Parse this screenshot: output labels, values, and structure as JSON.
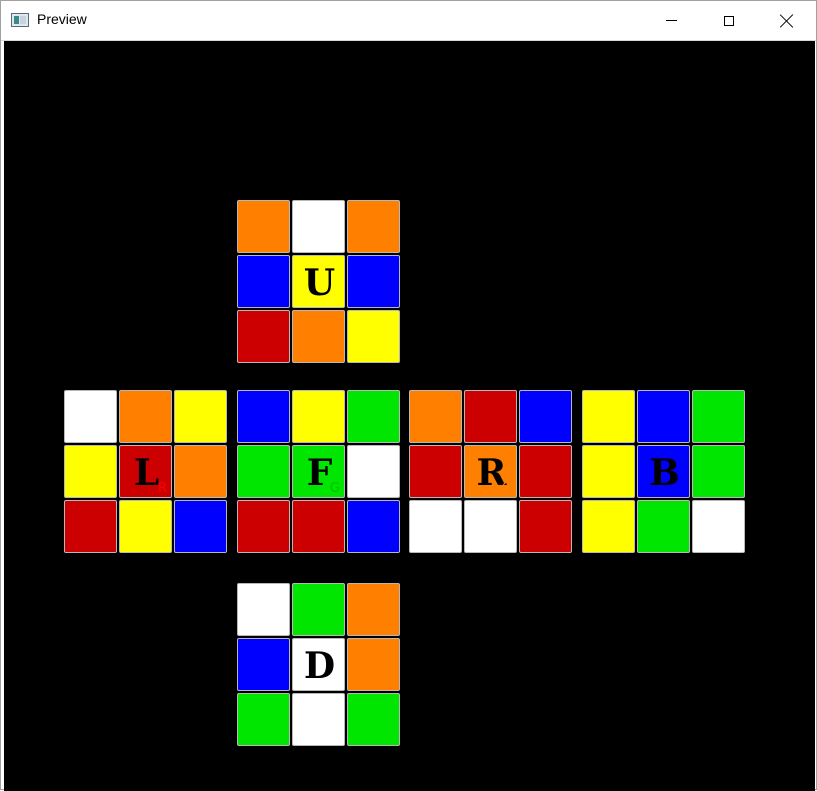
{
  "window": {
    "title": "Preview",
    "icon": "app-window-icon",
    "controls": [
      "minimize-icon",
      "maximize-icon",
      "close-icon"
    ]
  },
  "colors": {
    "W": "#ffffff",
    "O": "#ff8000",
    "B": "#0000ff",
    "Y": "#ffff00",
    "R": "#cc0000",
    "G": "#00e600",
    "background": "#000000"
  },
  "faces": {
    "U": {
      "label": "U",
      "sub": "",
      "sub_color": "",
      "stickers": [
        "O",
        "W",
        "O",
        "B",
        "Y",
        "B",
        "R",
        "O",
        "Y"
      ]
    },
    "L": {
      "label": "L",
      "sub": "R",
      "sub_color": "#ff0000",
      "stickers": [
        "W",
        "O",
        "Y",
        "Y",
        "R",
        "O",
        "R",
        "Y",
        "B"
      ]
    },
    "F": {
      "label": "F",
      "sub": "G",
      "sub_color": "#00c000",
      "stickers": [
        "B",
        "Y",
        "G",
        "G",
        "G",
        "W",
        "R",
        "R",
        "B"
      ]
    },
    "R": {
      "label": "R",
      "sub": "O",
      "sub_color": "#ff8000",
      "stickers": [
        "O",
        "R",
        "B",
        "R",
        "O",
        "R",
        "W",
        "W",
        "R"
      ]
    },
    "B": {
      "label": "B",
      "sub": "",
      "sub_color": "",
      "stickers": [
        "Y",
        "B",
        "G",
        "Y",
        "B",
        "G",
        "Y",
        "G",
        "W"
      ]
    },
    "D": {
      "label": "D",
      "sub": "",
      "sub_color": "",
      "stickers": [
        "W",
        "G",
        "O",
        "B",
        "W",
        "O",
        "G",
        "W",
        "G"
      ]
    }
  }
}
